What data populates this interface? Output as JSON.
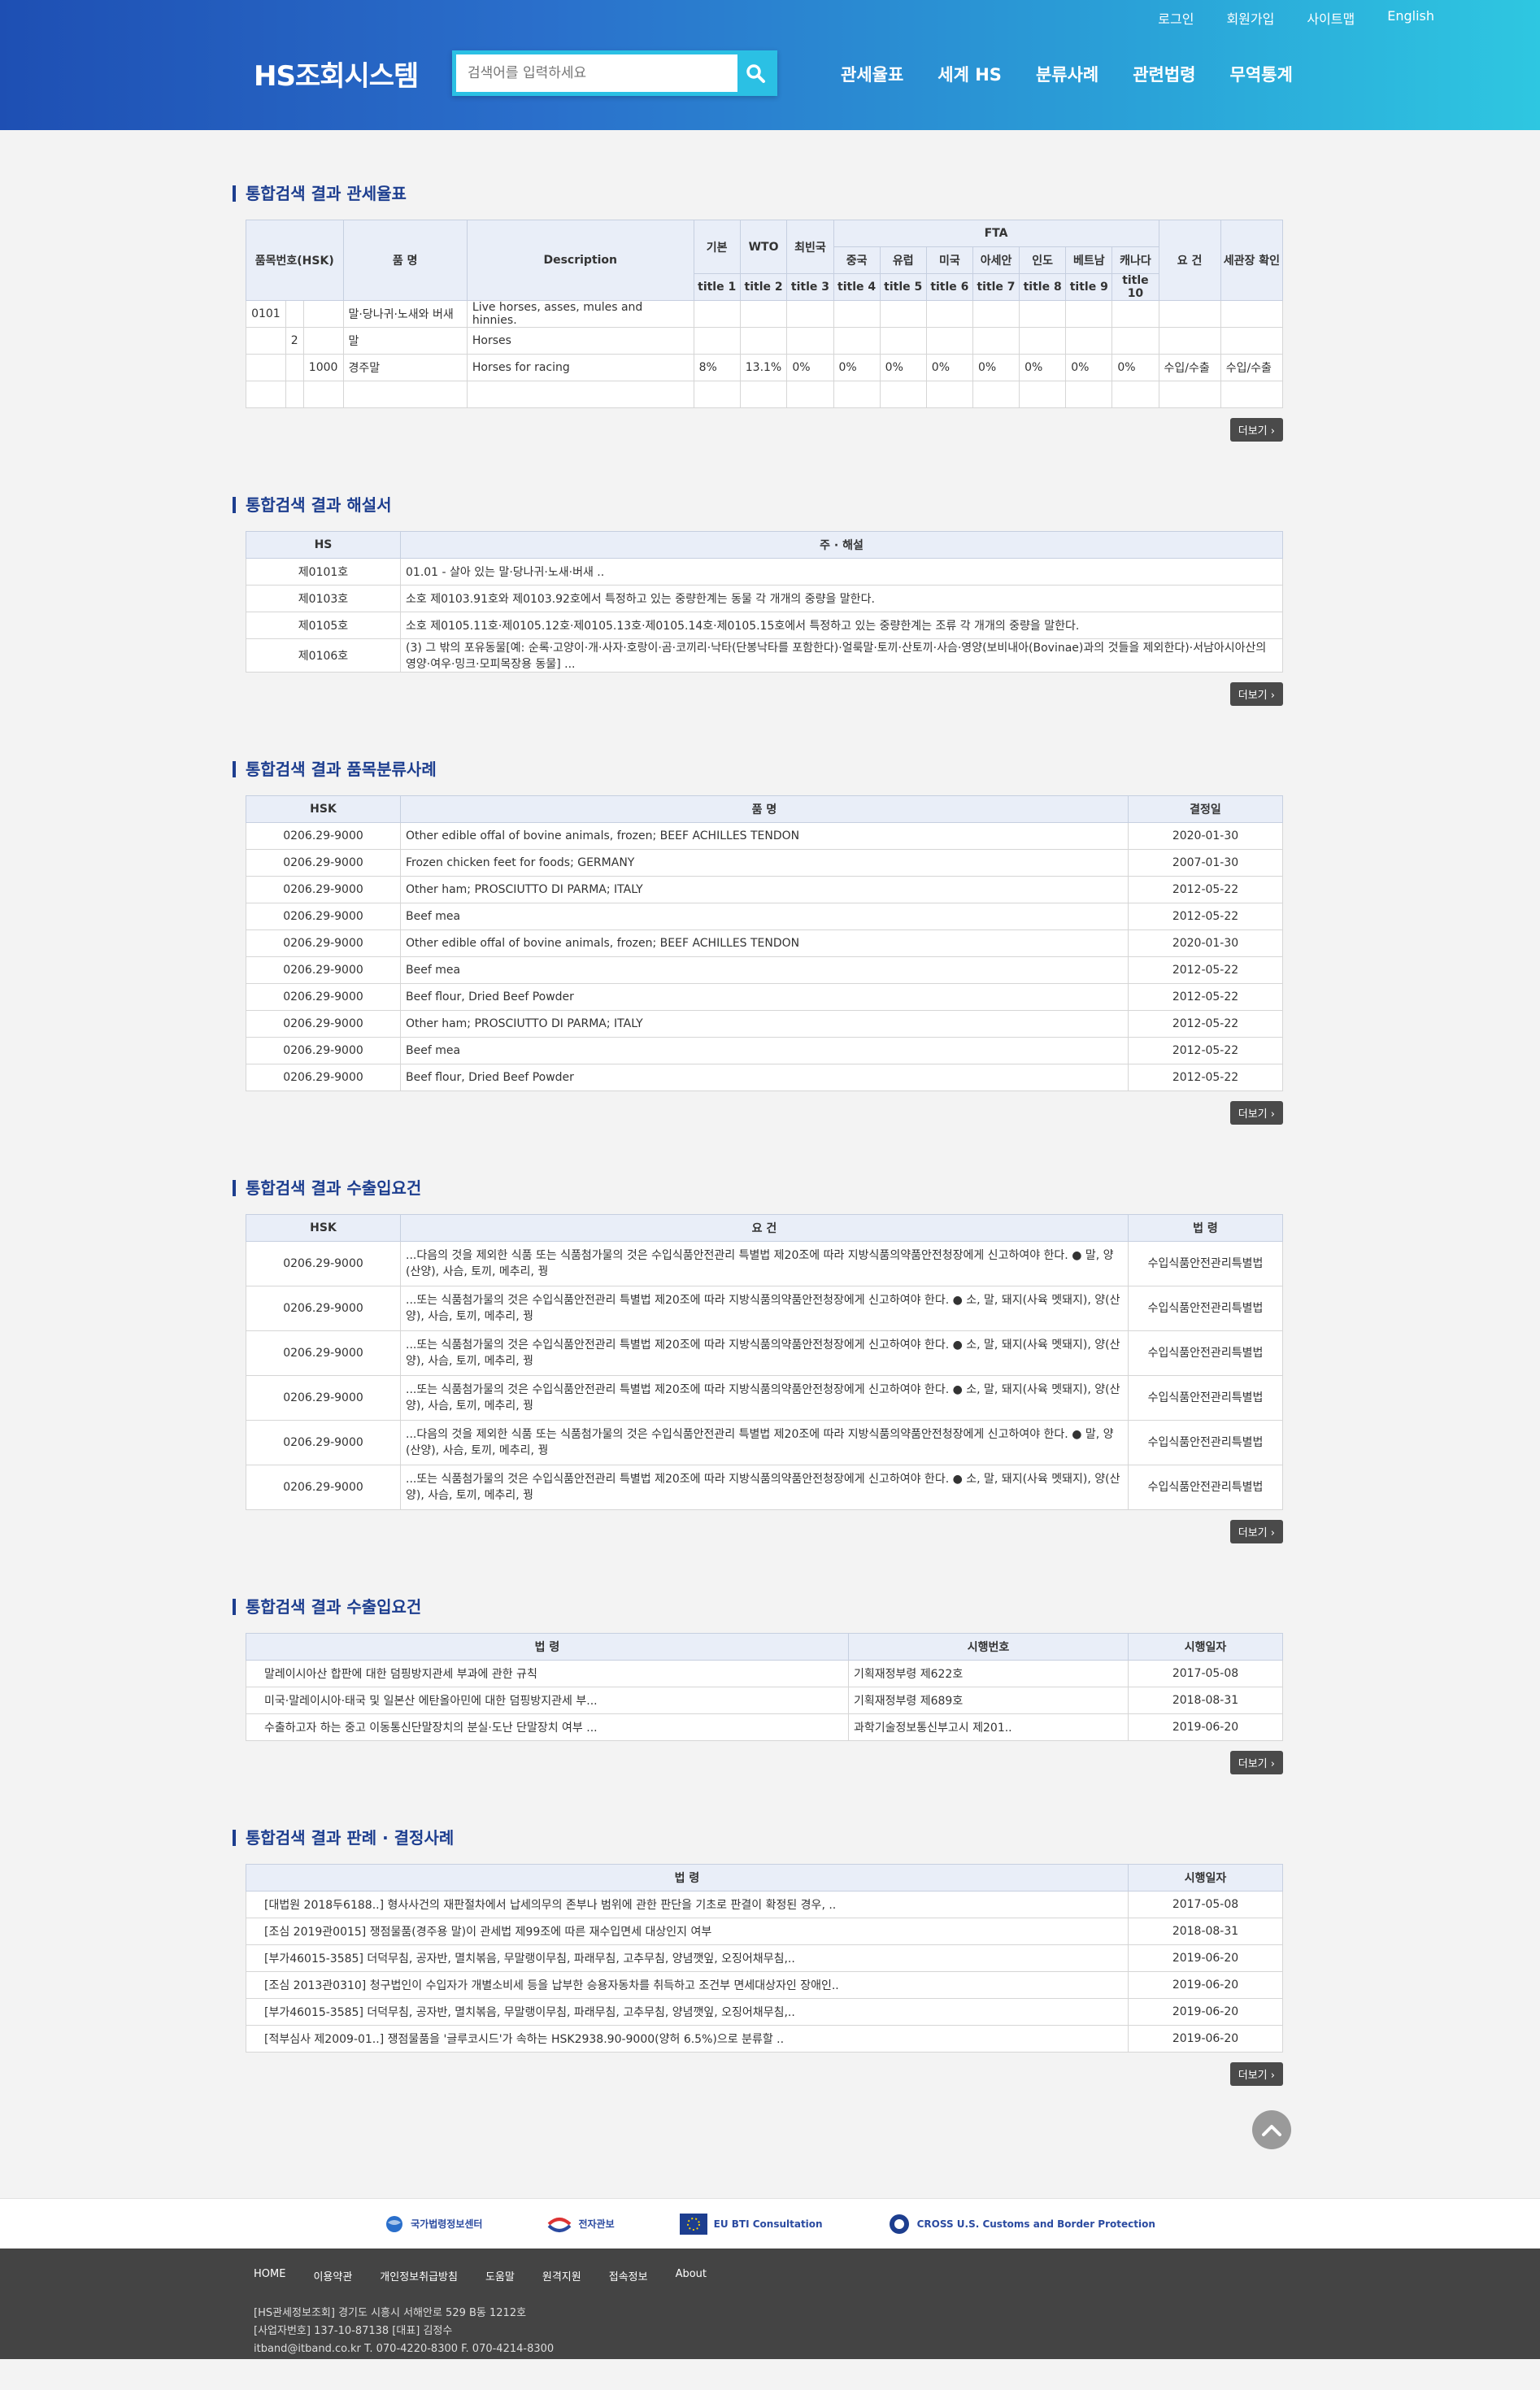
{
  "header": {
    "util": [
      "로그인",
      "회원가입",
      "사이트맵",
      "English"
    ],
    "logo": "HS조회시스템",
    "search_placeholder": "검색어를 입력하세요",
    "gnb": [
      "관세율표",
      "세계 HS",
      "분류사례",
      "관련법령",
      "무역통계"
    ]
  },
  "more_label": "더보기",
  "sections": {
    "tariff": {
      "title": "통합검색 결과 관세율표",
      "head": {
        "code": "품목번호(HSK)",
        "name": "품 명",
        "desc": "Description",
        "basic": "기본",
        "wto": "WTO",
        "poor": "최빈국",
        "fta": "FTA",
        "cond": "요 건",
        "customs": "세관장 확인",
        "fta_cols": [
          "중국",
          "유럽",
          "미국",
          "아세안",
          "인도",
          "베트남",
          "캐나다"
        ],
        "titles": [
          "title 1",
          "title 2",
          "title 3",
          "title 4",
          "title 5",
          "title 6",
          "title 7",
          "title 8",
          "title 9",
          "title 10"
        ]
      },
      "rows": [
        [
          "0101",
          "",
          "",
          "말·당나귀·노새와 버새",
          "Live horses, asses, mules and hinnies.",
          "",
          "",
          "",
          "",
          "",
          "",
          "",
          "",
          "",
          "",
          "",
          ""
        ],
        [
          "",
          "2",
          "",
          "말",
          "Horses",
          "",
          "",
          "",
          "",
          "",
          "",
          "",
          "",
          "",
          "",
          "",
          ""
        ],
        [
          "",
          "",
          "1000",
          "경주말",
          "Horses for racing",
          "8%",
          "13.1%",
          "0%",
          "0%",
          "0%",
          "0%",
          "0%",
          "0%",
          "0%",
          "0%",
          "수입/수출",
          "수입/수출"
        ],
        [
          "",
          "",
          "",
          "",
          "",
          "",
          "",
          "",
          "",
          "",
          "",
          "",
          "",
          "",
          "",
          "",
          ""
        ]
      ]
    },
    "commentary": {
      "title": "통합검색 결과 해설서",
      "head": [
        "HS",
        "주 · 해설"
      ],
      "rows": [
        [
          "제0101호",
          "01.01 - 살아 있는 말·당나귀·노새·버새 .."
        ],
        [
          "제0103호",
          "소호 제0103.91호와 제0103.92호에서 특정하고 있는 중량한계는 동물 각 개개의 중량을 말한다."
        ],
        [
          "제0105호",
          "소호 제0105.11호·제0105.12호·제0105.13호·제0105.14호·제0105.15호에서 특정하고 있는 중량한계는 조류 각 개개의 중량을 말한다."
        ],
        [
          "제0106호",
          "(3) 그 밖의 포유동물[예: 순록·고양이·개·사자·호랑이·곰·코끼리·낙타(단봉낙타를 포함한다)·얼룩말·토끼·산토끼·사슴·영양(보비내아(Bovinae)과의 것들을 제외한다)·서남아시아산의 영양·여우·밍크·모피목장용 동물] ..."
        ]
      ]
    },
    "cases": {
      "title": "통합검색 결과 품목분류사례",
      "head": [
        "HSK",
        "품 명",
        "결정일"
      ],
      "rows": [
        [
          "0206.29-9000",
          "Other edible offal of bovine animals, frozen; BEEF ACHILLES TENDON",
          "2020-01-30"
        ],
        [
          "0206.29-9000",
          "Frozen chicken feet for foods; GERMANY",
          "2007-01-30"
        ],
        [
          "0206.29-9000",
          "Other ham; PROSCIUTTO DI PARMA; ITALY",
          "2012-05-22"
        ],
        [
          "0206.29-9000",
          "Beef mea",
          "2012-05-22"
        ],
        [
          "0206.29-9000",
          "Other edible offal of bovine animals, frozen; BEEF ACHILLES TENDON",
          "2020-01-30"
        ],
        [
          "0206.29-9000",
          "Beef mea",
          "2012-05-22"
        ],
        [
          "0206.29-9000",
          "Beef flour, Dried Beef Powder",
          "2012-05-22"
        ],
        [
          "0206.29-9000",
          "Other ham; PROSCIUTTO DI PARMA; ITALY",
          "2012-05-22"
        ],
        [
          "0206.29-9000",
          "Beef mea",
          "2012-05-22"
        ],
        [
          "0206.29-9000",
          "Beef flour, Dried Beef Powder",
          "2012-05-22"
        ]
      ]
    },
    "requirements": {
      "title": "통합검색 결과 수출입요건",
      "head": [
        "HSK",
        "요 건",
        "법 령"
      ],
      "rows": [
        [
          "0206.29-9000",
          "...다음의 것을 제외한 식품 또는 식품첨가물의 것은 수입식품안전관리 특별법 제20조에 따라 지방식품의약품안전청장에게 신고하여야 한다. ● 말, 양(산양), 사슴, 토끼, 메추리, 꿩",
          "수입식품안전관리특별법"
        ],
        [
          "0206.29-9000",
          "...또는 식품첨가물의 것은 수입식품안전관리 특별법 제20조에 따라 지방식품의약품안전청장에게 신고하여야 한다. ● 소, 말, 돼지(사육 멧돼지), 양(산양), 사슴, 토끼, 메추리, 꿩",
          "수입식품안전관리특별법"
        ],
        [
          "0206.29-9000",
          "...또는 식품첨가물의 것은 수입식품안전관리 특별법 제20조에 따라 지방식품의약품안전청장에게 신고하여야 한다. ● 소, 말, 돼지(사육 멧돼지), 양(산양), 사슴, 토끼, 메추리, 꿩",
          "수입식품안전관리특별법"
        ],
        [
          "0206.29-9000",
          "...또는 식품첨가물의 것은 수입식품안전관리 특별법 제20조에 따라 지방식품의약품안전청장에게 신고하여야 한다. ● 소, 말, 돼지(사육 멧돼지), 양(산양), 사슴, 토끼, 메추리, 꿩",
          "수입식품안전관리특별법"
        ],
        [
          "0206.29-9000",
          "...다음의 것을 제외한 식품 또는 식품첨가물의 것은 수입식품안전관리 특별법 제20조에 따라 지방식품의약품안전청장에게 신고하여야 한다. ● 말, 양(산양), 사슴, 토끼, 메추리, 꿩",
          "수입식품안전관리특별법"
        ],
        [
          "0206.29-9000",
          "...또는 식품첨가물의 것은 수입식품안전관리 특별법 제20조에 따라 지방식품의약품안전청장에게 신고하여야 한다. ● 소, 말, 돼지(사육 멧돼지), 양(산양), 사슴, 토끼, 메추리, 꿩",
          "수입식품안전관리특별법"
        ]
      ]
    },
    "laws": {
      "title": "통합검색 결과 수출입요건",
      "head": [
        "법 령",
        "시행번호",
        "시행일자"
      ],
      "rows": [
        [
          "말레이시아산 합판에 대한 덤핑방지관세 부과에 관한 규칙",
          "기획재정부령 제622호",
          "2017-05-08"
        ],
        [
          "미국·말레이시아·태국 및 일본산 에탄올아민에 대한 덤핑방지관세 부...",
          "기획재정부령 제689호",
          "2018-08-31"
        ],
        [
          "수출하고자 하는 중고 이동통신단말장치의 분실·도난 단말장치 여부 ...",
          "과학기술정보통신부고시 제201..",
          "2019-06-20"
        ]
      ]
    },
    "rulings": {
      "title": "통합검색 결과 판례 · 결정사례",
      "head": [
        "법 령",
        "시행일자"
      ],
      "rows": [
        [
          "[대법원 2018두6188..] 형사사건의 재판절차에서 납세의무의 존부나 범위에 관한 판단을 기초로 판결이 확정된 경우, ..",
          "2017-05-08"
        ],
        [
          "[조심 2019관0015] 쟁점물품(경주용 말)이 관세법 제99조에 따른 재수입면세 대상인지 여부",
          "2018-08-31"
        ],
        [
          "[부가46015-3585] 더덕무침, 공자반, 멸치볶음, 무말랭이무침, 파래무침, 고추무침, 양념깻잎, 오징어채무침,..",
          "2019-06-20"
        ],
        [
          "[조심 2013관0310] 청구법인이 수입자가 개별소비세 등을 납부한 승용자동차를 취득하고 조건부 면세대상자인 장애인..",
          "2019-06-20"
        ],
        [
          "[부가46015-3585] 더덕무침, 공자반, 멸치볶음, 무말랭이무침, 파래무침, 고추무침, 양념깻잎, 오징어채무침,..",
          "2019-06-20"
        ],
        [
          "[적부심사 제2009-01..] 쟁점물품을 '글루코시드'가 속하는 HSK2938.90-9000(양허 6.5%)으로 분류할 ..",
          "2019-06-20"
        ]
      ]
    }
  },
  "partners": [
    "국가법령정보센터",
    "전자관보",
    "EU BTI Consultation",
    "CROSS U.S. Customs and Border Protection"
  ],
  "footer": {
    "nav": [
      "HOME",
      "이용약관",
      "개인정보취급방침",
      "도움말",
      "원격지원",
      "접속정보",
      "About"
    ],
    "info": [
      "[HS관세정보조회] 경기도 시흥시 서해안로 529 B동 1212호",
      "[사업자번호] 137-10-87138 [대표] 김정수",
      "itband@itband.co.kr T. 070-4220-8300 F. 070-4214-8300"
    ]
  }
}
